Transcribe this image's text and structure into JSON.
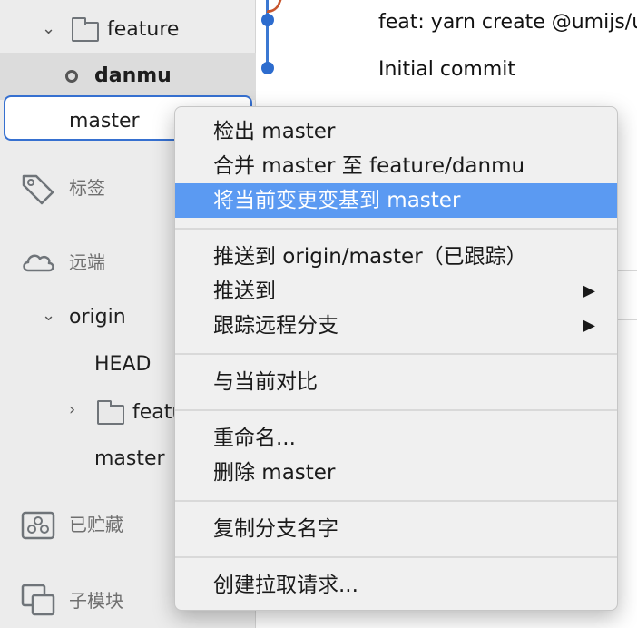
{
  "sidebar": {
    "branches": {
      "feature_folder": "feature",
      "current_branch": "danmu",
      "master_input_value": "master"
    },
    "tags_label": "标签",
    "remotes_label": "远端",
    "remote": {
      "name": "origin",
      "head": "HEAD",
      "feature_folder": "featu",
      "master": "master"
    },
    "stashes_label": "已贮藏",
    "submodules_label": "子模块"
  },
  "graph": {
    "commits": [
      {
        "message": "feat: yarn create @umijs/u"
      },
      {
        "message": "Initial commit"
      }
    ]
  },
  "context_menu": {
    "checkout": "检出 master",
    "merge": "合并 master 至 feature/danmu",
    "rebase": "将当前变更变基到 master",
    "push_tracking": "推送到 origin/master（已跟踪）",
    "push_to": "推送到",
    "track_remote": "跟踪远程分支",
    "compare": "与当前对比",
    "rename": "重命名...",
    "delete": "删除 master",
    "copy_name": "复制分支名字",
    "create_pr": "创建拉取请求...",
    "submenu_arrow": "▶",
    "highlight_color": "#5b9af2"
  },
  "colors": {
    "accent": "#3670d0",
    "graph_line": "#3b78d2",
    "graph_branch": "#c8552d"
  }
}
